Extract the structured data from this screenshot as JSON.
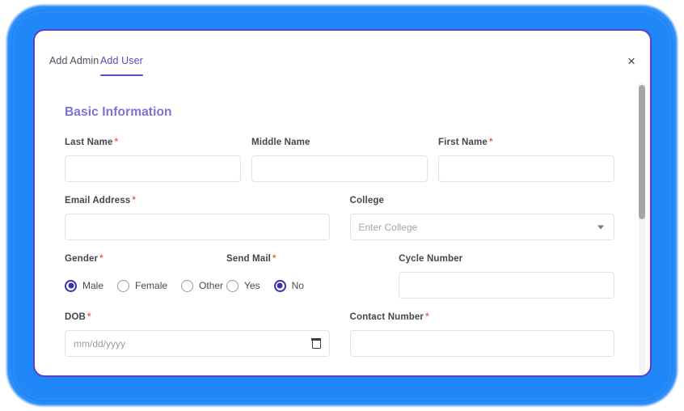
{
  "modal": {
    "close_label": "×",
    "tabs": [
      {
        "label": "Add Admin",
        "active": false
      },
      {
        "label": "Add User",
        "active": true
      }
    ]
  },
  "form": {
    "section_title": "Basic Information",
    "required_marker": "*",
    "fields": {
      "last_name": {
        "label": "Last Name",
        "required": true,
        "value": "",
        "placeholder": ""
      },
      "middle_name": {
        "label": "Middle Name",
        "required": false,
        "value": "",
        "placeholder": ""
      },
      "first_name": {
        "label": "First Name",
        "required": true,
        "value": "",
        "placeholder": ""
      },
      "email": {
        "label": "Email Address",
        "required": true,
        "value": "",
        "placeholder": ""
      },
      "college": {
        "label": "College",
        "required": false,
        "value": "",
        "placeholder": "Enter College"
      },
      "gender": {
        "label": "Gender",
        "required": true,
        "selected": "Male",
        "options": [
          "Male",
          "Female",
          "Other"
        ]
      },
      "send_mail": {
        "label": "Send Mail",
        "required": true,
        "selected": "No",
        "options": [
          "Yes",
          "No"
        ]
      },
      "cycle_number": {
        "label": "Cycle Number",
        "required": false,
        "value": "",
        "placeholder": ""
      },
      "dob": {
        "label": "DOB",
        "required": true,
        "value": "",
        "placeholder": "mm/dd/yyyy"
      },
      "contact": {
        "label": "Contact Number",
        "required": true,
        "value": "",
        "placeholder": ""
      }
    }
  },
  "colors": {
    "backdrop_blue": "#1f87f7",
    "modal_border_purple": "#5b3fc4",
    "section_heading": "#7b72d6",
    "tab_active": "#5a4ab5",
    "required_asterisk": "#f4624a",
    "radio_selected": "#3a32a8",
    "scrollbar_thumb": "#a6a6a6"
  }
}
